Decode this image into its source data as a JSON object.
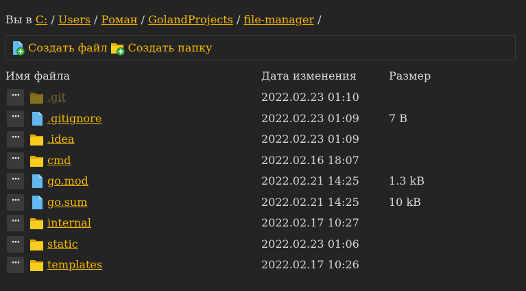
{
  "breadcrumb": {
    "prefix": "Вы в",
    "items": [
      "C:",
      "Users",
      "Роман",
      "GolandProjects",
      "file-manager"
    ],
    "sep": "/"
  },
  "toolbar": {
    "create_file": "Создать файл",
    "create_folder": "Создать папку"
  },
  "table": {
    "headers": {
      "name": "Имя файла",
      "date": "Дата изменения",
      "size": "Размер"
    },
    "rows": [
      {
        "menu": "···",
        "name": ".git",
        "type": "folder",
        "date": "2022.02.23 01:10",
        "size": "",
        "dimmed": true
      },
      {
        "menu": "···",
        "name": ".gitignore",
        "type": "file",
        "date": "2022.02.23 01:09",
        "size": "7 B"
      },
      {
        "menu": "···",
        "name": ".idea",
        "type": "folder",
        "date": "2022.02.23 01:09",
        "size": ""
      },
      {
        "menu": "···",
        "name": "cmd",
        "type": "folder",
        "date": "2022.02.16 18:07",
        "size": ""
      },
      {
        "menu": "···",
        "name": "go.mod",
        "type": "file",
        "date": "2022.02.21 14:25",
        "size": "1.3 kB"
      },
      {
        "menu": "···",
        "name": "go.sum",
        "type": "file",
        "date": "2022.02.21 14:25",
        "size": "10 kB"
      },
      {
        "menu": "···",
        "name": "internal",
        "type": "folder",
        "date": "2022.02.17 10:27",
        "size": ""
      },
      {
        "menu": "···",
        "name": "static",
        "type": "folder",
        "date": "2022.02.23 01:06",
        "size": ""
      },
      {
        "menu": "···",
        "name": "templates",
        "type": "folder",
        "date": "2022.02.17 10:26",
        "size": ""
      }
    ]
  },
  "colors": {
    "background": "#242424",
    "link": "#f5b800",
    "folder": "#f9cd1f",
    "file": "#62b7ee"
  }
}
